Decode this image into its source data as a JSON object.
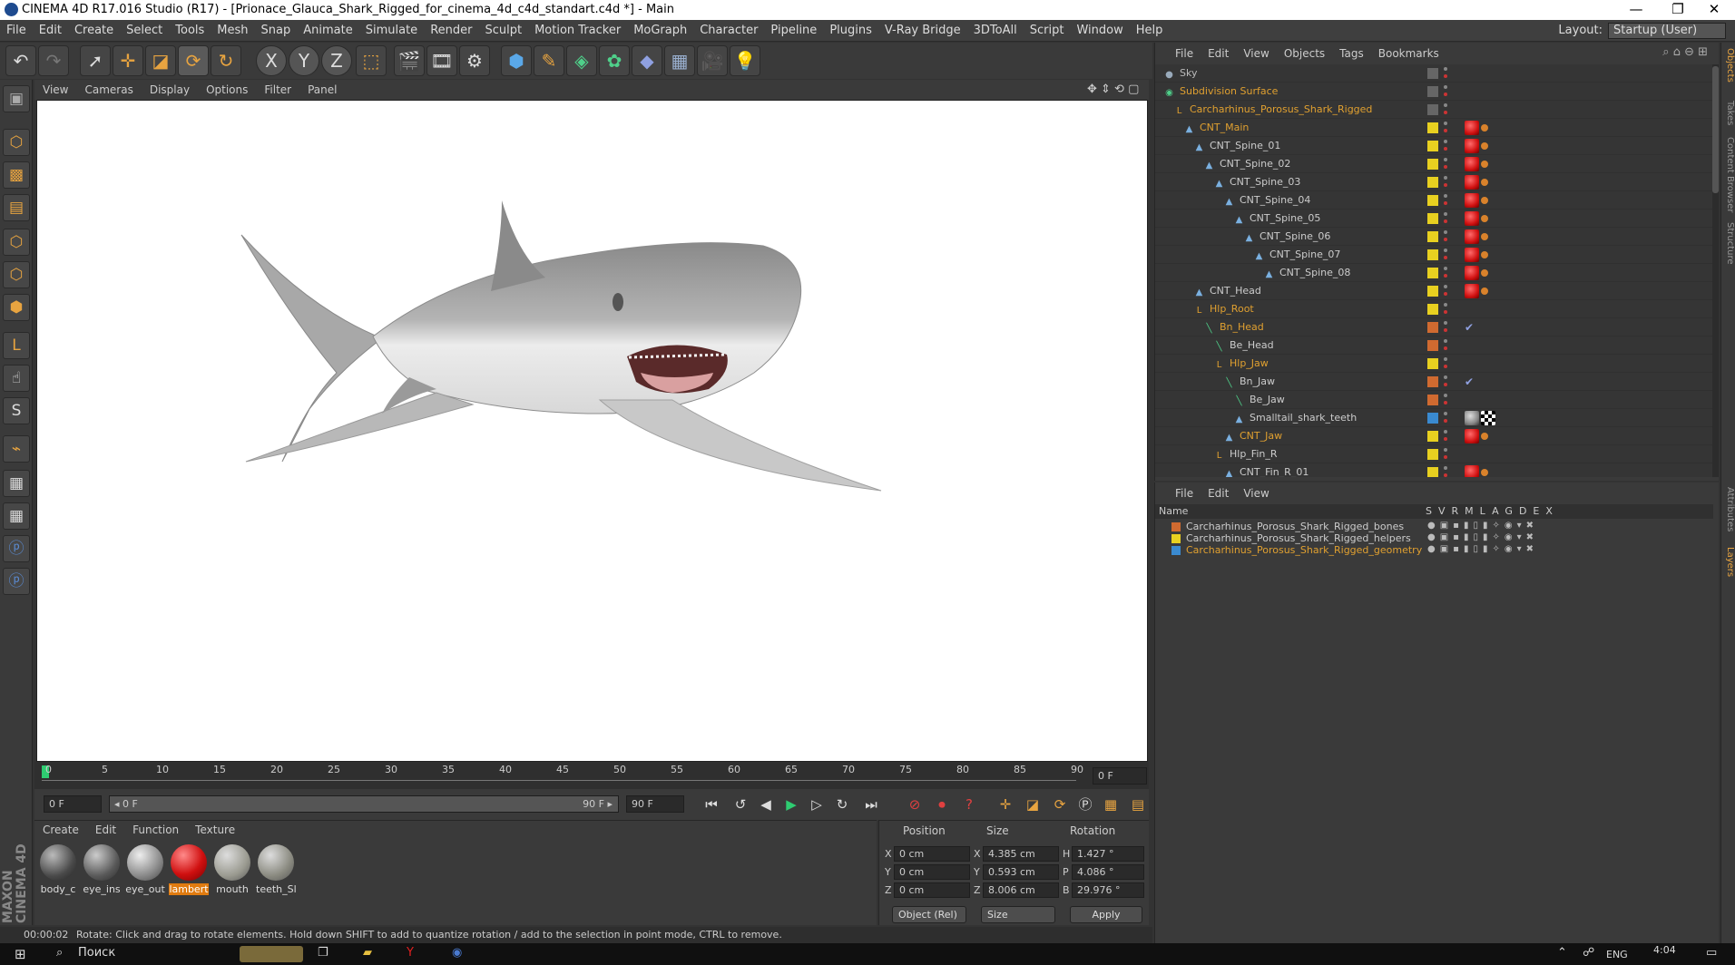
{
  "window": {
    "title": "CINEMA 4D R17.016 Studio (R17) - [Prionace_Glauca_Shark_Rigged_for_cinema_4d_c4d_standart.c4d *] - Main",
    "controls": [
      "—",
      "❐",
      "✕"
    ]
  },
  "menubar": {
    "items": [
      "File",
      "Edit",
      "Create",
      "Select",
      "Tools",
      "Mesh",
      "Snap",
      "Animate",
      "Simulate",
      "Render",
      "Sculpt",
      "Motion Tracker",
      "MoGraph",
      "Character",
      "Pipeline",
      "Plugins",
      "V-Ray Bridge",
      "3DToAll",
      "Script",
      "Window",
      "Help"
    ],
    "layout_label": "Layout:",
    "layout_value": "Startup (User)"
  },
  "toolbar": {
    "icons": [
      "undo-icon",
      "redo-icon",
      "select-arrow-icon",
      "move-icon",
      "scale-icon",
      "rotate-icon",
      "live-rotate-icon",
      "x-axis-icon",
      "y-axis-icon",
      "z-axis-icon",
      "coordinate-system-icon",
      "render-view-icon",
      "render-picture-viewer-icon",
      "render-settings-icon",
      "cube-icon",
      "pen-spline-icon",
      "subdivision-icon",
      "cloner-icon",
      "deformer-icon",
      "floor-icon",
      "camera-icon",
      "light-icon"
    ],
    "axis_labels": [
      "X",
      "Y",
      "Z"
    ]
  },
  "viewport": {
    "menu": [
      "View",
      "Cameras",
      "Display",
      "Options",
      "Filter",
      "Panel"
    ]
  },
  "timeline": {
    "ticks": [
      "0",
      "5",
      "10",
      "15",
      "20",
      "25",
      "30",
      "35",
      "40",
      "45",
      "50",
      "55",
      "60",
      "65",
      "70",
      "75",
      "80",
      "85",
      "90"
    ],
    "current_frame_field": "0 F",
    "start_field": "0 F",
    "range_left": "◂ 0 F",
    "range_right": "90 F ▸",
    "end_field": "90 F",
    "end_field2": "90 F"
  },
  "materials": {
    "menu": [
      "Create",
      "Edit",
      "Function",
      "Texture"
    ],
    "items": [
      {
        "label": "body_c",
        "color": "#5a5a5a"
      },
      {
        "label": "eye_ins",
        "color": "#6b6b6b"
      },
      {
        "label": "eye_out",
        "color": "#8a8a8a"
      },
      {
        "label": "lambert",
        "color": "#d01010"
      },
      {
        "label": "mouth",
        "color": "#9a9a90"
      },
      {
        "label": "teeth_Sl",
        "color": "#8a8a80"
      }
    ],
    "selected": "lambert",
    "maxon_brand": "MAXON CINEMA 4D"
  },
  "coords": {
    "headers": [
      "Position",
      "Size",
      "Rotation"
    ],
    "rows": [
      {
        "axis": "X",
        "pos": "0 cm",
        "size_axis": "X",
        "size": "4.385 cm",
        "rot_axis": "H",
        "rot": "1.427 °"
      },
      {
        "axis": "Y",
        "pos": "0 cm",
        "size_axis": "Y",
        "size": "0.593 cm",
        "rot_axis": "P",
        "rot": "4.086 °"
      },
      {
        "axis": "Z",
        "pos": "0 cm",
        "size_axis": "Z",
        "size": "8.006 cm",
        "rot_axis": "B",
        "rot": "29.976 °"
      }
    ],
    "mode": "Object (Rel)",
    "size_mode": "Size",
    "apply": "Apply"
  },
  "status": {
    "time": "00:00:02",
    "message": "Rotate: Click and drag to rotate elements. Hold down SHIFT to add to quantize rotation / add to the selection in point mode, CTRL to remove."
  },
  "objects": {
    "menu": [
      "File",
      "Edit",
      "View",
      "Objects",
      "Tags",
      "Bookmarks"
    ],
    "rows": [
      {
        "name": "Sky",
        "indent": 0,
        "color": "#bbbbbb",
        "icon": "sky-icon",
        "vis": "#666",
        "tag": "none"
      },
      {
        "name": "Subdivision Surface",
        "indent": 0,
        "color": "#e0a030",
        "icon": "subdivision-icon",
        "vis": "#666",
        "tag": "none"
      },
      {
        "name": "Carcharhinus_Porosus_Shark_Rigged",
        "indent": 1,
        "color": "#e0a030",
        "icon": "null-icon",
        "vis": "#666",
        "tag": "none"
      },
      {
        "name": "CNT_Main",
        "indent": 2,
        "color": "#e0a030",
        "icon": "joint-icon",
        "vis": "#e8d020",
        "tag": "red"
      },
      {
        "name": "CNT_Spine_01",
        "indent": 3,
        "color": "#cccccc",
        "icon": "joint-icon",
        "vis": "#e8d020",
        "tag": "red"
      },
      {
        "name": "CNT_Spine_02",
        "indent": 4,
        "color": "#cccccc",
        "icon": "joint-icon",
        "vis": "#e8d020",
        "tag": "red"
      },
      {
        "name": "CNT_Spine_03",
        "indent": 5,
        "color": "#cccccc",
        "icon": "joint-icon",
        "vis": "#e8d020",
        "tag": "red"
      },
      {
        "name": "CNT_Spine_04",
        "indent": 6,
        "color": "#cccccc",
        "icon": "joint-icon",
        "vis": "#e8d020",
        "tag": "red"
      },
      {
        "name": "CNT_Spine_05",
        "indent": 7,
        "color": "#cccccc",
        "icon": "joint-icon",
        "vis": "#e8d020",
        "tag": "red"
      },
      {
        "name": "CNT_Spine_06",
        "indent": 8,
        "color": "#cccccc",
        "icon": "joint-icon",
        "vis": "#e8d020",
        "tag": "red"
      },
      {
        "name": "CNT_Spine_07",
        "indent": 9,
        "color": "#cccccc",
        "icon": "joint-icon",
        "vis": "#e8d020",
        "tag": "red"
      },
      {
        "name": "CNT_Spine_08",
        "indent": 10,
        "color": "#cccccc",
        "icon": "joint-icon",
        "vis": "#e8d020",
        "tag": "red"
      },
      {
        "name": "CNT_Head",
        "indent": 3,
        "color": "#cccccc",
        "icon": "joint-icon",
        "vis": "#e8d020",
        "tag": "red"
      },
      {
        "name": "Hlp_Root",
        "indent": 3,
        "color": "#e0a030",
        "icon": "null-icon",
        "vis": "#e8d020",
        "tag": "none"
      },
      {
        "name": "Bn_Head",
        "indent": 4,
        "color": "#e0a030",
        "icon": "bone-icon",
        "vis": "#d06a30",
        "tag": "ik"
      },
      {
        "name": "Be_Head",
        "indent": 5,
        "color": "#cccccc",
        "icon": "bone-icon",
        "vis": "#d06a30",
        "tag": "none"
      },
      {
        "name": "Hlp_Jaw",
        "indent": 5,
        "color": "#e0a030",
        "icon": "null-icon",
        "vis": "#e8d020",
        "tag": "none"
      },
      {
        "name": "Bn_Jaw",
        "indent": 6,
        "color": "#cccccc",
        "icon": "bone-icon",
        "vis": "#d06a30",
        "tag": "ik"
      },
      {
        "name": "Be_Jaw",
        "indent": 7,
        "color": "#cccccc",
        "icon": "bone-icon",
        "vis": "#d06a30",
        "tag": "none"
      },
      {
        "name": "Smalltail_shark_teeth",
        "indent": 7,
        "color": "#cccccc",
        "icon": "joint-icon",
        "vis": "#3a8ad0",
        "tag": "material"
      },
      {
        "name": "CNT_Jaw",
        "indent": 6,
        "color": "#e0a030",
        "icon": "joint-icon",
        "vis": "#e8d020",
        "tag": "red"
      },
      {
        "name": "Hlp_Fin_R",
        "indent": 5,
        "color": "#cccccc",
        "icon": "null-icon",
        "vis": "#e8d020",
        "tag": "none"
      },
      {
        "name": "CNT_Fin_R_01",
        "indent": 6,
        "color": "#cccccc",
        "icon": "joint-icon",
        "vis": "#e8d020",
        "tag": "red"
      }
    ]
  },
  "layers": {
    "menu": [
      "File",
      "Edit",
      "View"
    ],
    "header": {
      "name": "Name",
      "cols": [
        "S",
        "V",
        "R",
        "M",
        "L",
        "A",
        "G",
        "D",
        "E",
        "X"
      ]
    },
    "rows": [
      {
        "name": "Carcharhinus_Porosus_Shark_Rigged_bones",
        "color": "#d06a30",
        "text_color": "#cccccc"
      },
      {
        "name": "Carcharhinus_Porosus_Shark_Rigged_helpers",
        "color": "#e8d020",
        "text_color": "#cccccc"
      },
      {
        "name": "Carcharhinus_Porosus_Shark_Rigged_geometry",
        "color": "#3a8ad0",
        "text_color": "#e0a030"
      }
    ]
  },
  "side_tabs": [
    "Objects",
    "Takes",
    "Content Browser",
    "Structure",
    "Attributes",
    "Layers"
  ],
  "taskbar": {
    "search": "Поиск",
    "lang": "ENG",
    "clock": "4:04"
  }
}
